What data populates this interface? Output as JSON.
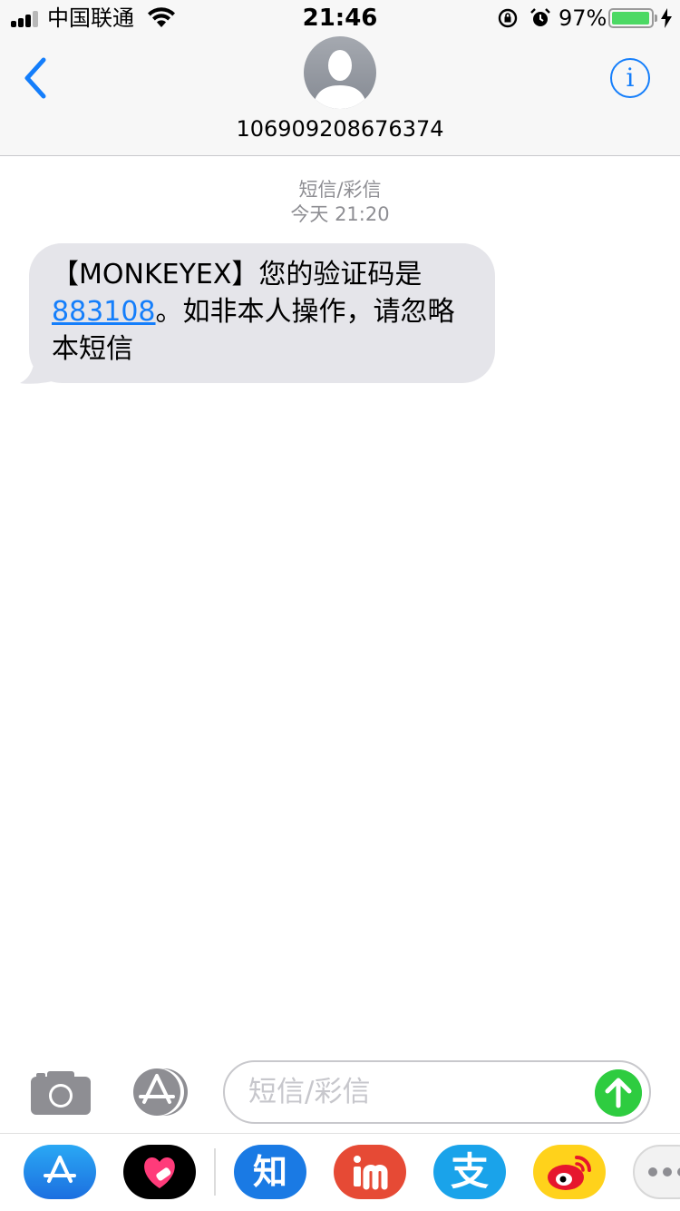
{
  "status_bar": {
    "carrier": "中国联通",
    "time": "21:46",
    "battery_percent": "97%",
    "battery_level": 0.97
  },
  "header": {
    "contact": "106909208676374"
  },
  "conversation": {
    "service": "短信/彩信",
    "timestamp": "今天 21:20",
    "message": {
      "part1": "【MONKEYEX】您的验证码是",
      "code": "883108",
      "part2": "。如非本人操作，请忽略本短信"
    }
  },
  "composer": {
    "placeholder": "短信/彩信"
  },
  "app_drawer": {
    "zhihu_label": "知",
    "alipay_label": "支"
  },
  "colors": {
    "accent": "#147efb",
    "bubble": "#e5e5ea",
    "send": "#2ecc40"
  }
}
